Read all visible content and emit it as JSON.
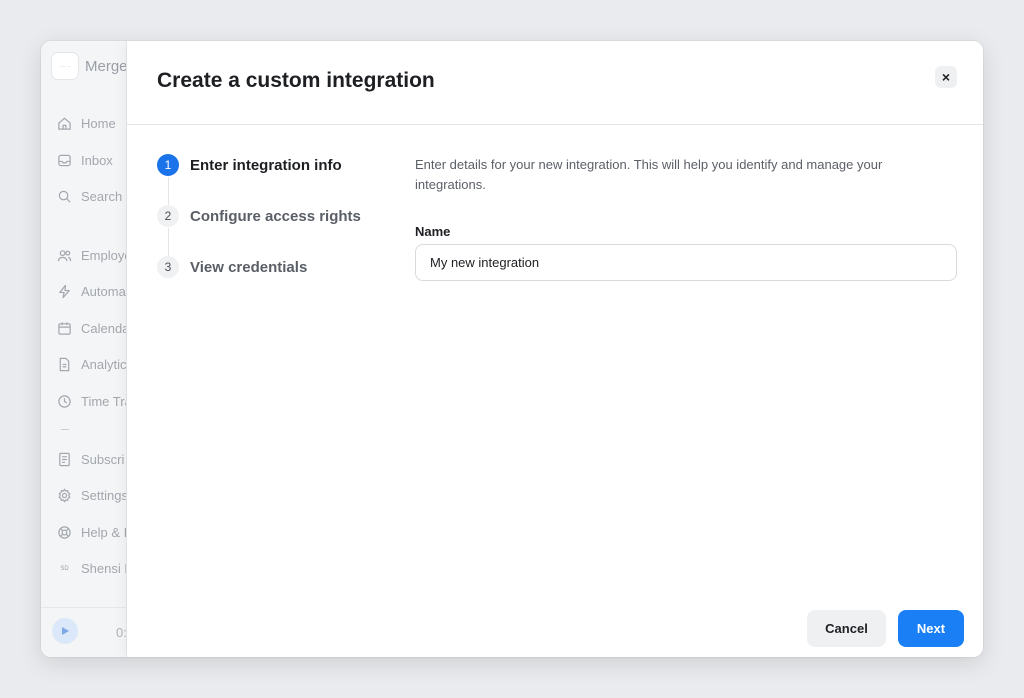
{
  "app": {
    "brand_name": "Merge",
    "logo_text": "···· ···"
  },
  "sidebar": {
    "items": [
      {
        "label": "Home",
        "icon": "home-icon"
      },
      {
        "label": "Inbox",
        "icon": "inbox-icon"
      },
      {
        "label": "Search",
        "icon": "search-icon"
      },
      {
        "label": "Employe",
        "icon": "users-icon"
      },
      {
        "label": "Automa",
        "icon": "bolt-icon"
      },
      {
        "label": "Calenda",
        "icon": "calendar-icon"
      },
      {
        "label": "Analytic",
        "icon": "document-icon"
      },
      {
        "label": "Time Tra",
        "icon": "clock-icon"
      },
      {
        "label": "Subscri",
        "icon": "receipt-icon"
      },
      {
        "label": "Settings",
        "icon": "gear-icon"
      },
      {
        "label": "Help & I",
        "icon": "lifebuoy-icon"
      },
      {
        "label": "Shensi D",
        "icon": "avatar",
        "avatar_text": "SD"
      }
    ],
    "player_time": "0:"
  },
  "modal": {
    "title": "Create a custom integration",
    "close_label": "×",
    "steps": [
      {
        "number": "1",
        "label": "Enter integration info",
        "active": true
      },
      {
        "number": "2",
        "label": "Configure access rights",
        "active": false
      },
      {
        "number": "3",
        "label": "View credentials",
        "active": false
      }
    ],
    "description": "Enter details for your new integration. This will help you identify and manage your integrations.",
    "name_field": {
      "label": "Name",
      "value": "My new integration"
    },
    "cancel_label": "Cancel",
    "next_label": "Next"
  },
  "colors": {
    "accent": "#1a7ff5",
    "step_active": "#1a73e8"
  }
}
